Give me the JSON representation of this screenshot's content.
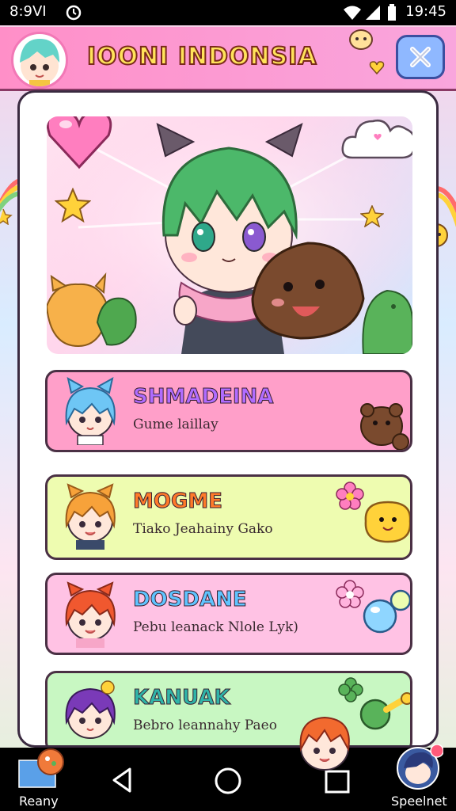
{
  "status_bar": {
    "time": "8:9VI",
    "clock_right": "19:45",
    "icons": [
      "alarm-icon",
      "wifi-icon",
      "signal-icon",
      "battery-icon"
    ]
  },
  "header": {
    "title": "IOONI INDONSIA",
    "close_icon": "close-icon"
  },
  "list": [
    {
      "name": "SHMADEINA",
      "subtitle": "Gume laillay",
      "bg": "#ff9fc9",
      "name_color": "#b06cff",
      "hair": "#6ec6f5"
    },
    {
      "name": "MOGME",
      "subtitle": "Tiako Jeahainy Gako",
      "bg": "#eefcb0",
      "name_color": "#ff7a2a",
      "hair": "#f7a23a"
    },
    {
      "name": "DOSDANE",
      "subtitle": "Pebu leanack Nlole Lyk)",
      "bg": "#ffc2e4",
      "name_color": "#5fc4ff",
      "hair": "#f0582f"
    },
    {
      "name": "KANUAK",
      "subtitle": "Bebro leannahy Paeo",
      "bg": "#c8f7c2",
      "name_color": "#2fb4a8",
      "hair": "#7a3ab8"
    }
  ],
  "navbar": {
    "left_label": "Reany",
    "right_label": "Speelnet"
  },
  "colors": {
    "header_pink": "#ff8fc8",
    "title_yellow": "#ffe35a",
    "close_blue": "#8fb8ff"
  }
}
